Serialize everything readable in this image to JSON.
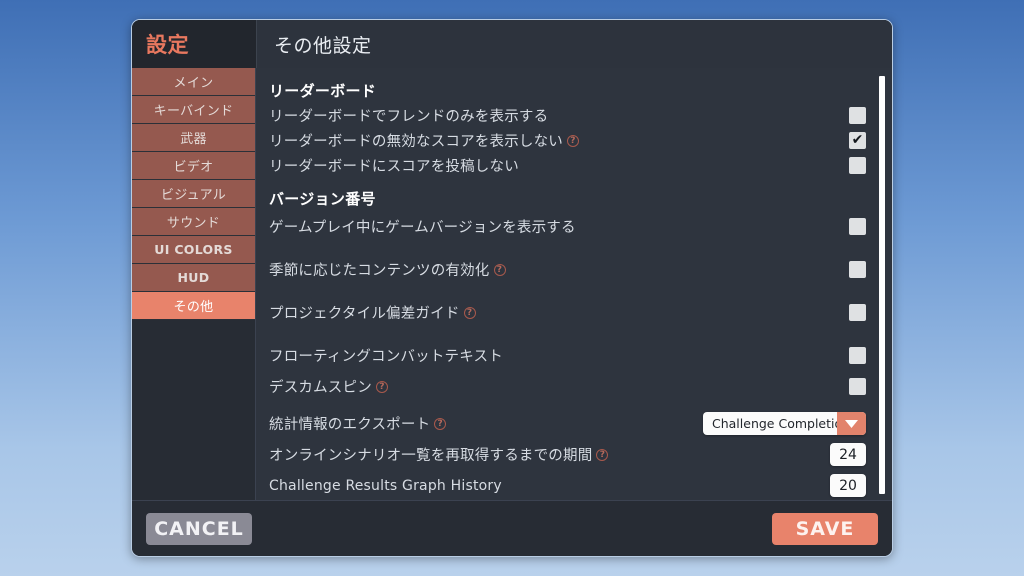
{
  "window": {
    "app_title": "設定",
    "page_title": "その他設定"
  },
  "sidebar": {
    "items": [
      {
        "label": "メイン",
        "active": false,
        "latin": false
      },
      {
        "label": "キーバインド",
        "active": false,
        "latin": false
      },
      {
        "label": "武器",
        "active": false,
        "latin": false
      },
      {
        "label": "ビデオ",
        "active": false,
        "latin": false
      },
      {
        "label": "ビジュアル",
        "active": false,
        "latin": false
      },
      {
        "label": "サウンド",
        "active": false,
        "latin": false
      },
      {
        "label": "UI COLORS",
        "active": false,
        "latin": true
      },
      {
        "label": "HUD",
        "active": false,
        "latin": true
      },
      {
        "label": "その他",
        "active": true,
        "latin": false
      }
    ]
  },
  "content": {
    "group_leaderboard": "リーダーボード",
    "group_version": "バージョン番号",
    "rows": {
      "friends_only": {
        "label": "リーダーボードでフレンドのみを表示する",
        "checked": false,
        "help": false
      },
      "hide_invalid": {
        "label": "リーダーボードの無効なスコアを表示しない",
        "checked": true,
        "help": true
      },
      "no_submit": {
        "label": "リーダーボードにスコアを投稿しない",
        "checked": false,
        "help": false
      },
      "show_version": {
        "label": "ゲームプレイ中にゲームバージョンを表示する",
        "checked": false,
        "help": false
      },
      "seasonal": {
        "label": "季節に応じたコンテンツの有効化",
        "checked": false,
        "help": true
      },
      "projectile": {
        "label": "プロジェクタイル偏差ガイド",
        "checked": false,
        "help": true
      },
      "floating_text": {
        "label": "フローティングコンバットテキスト",
        "checked": false,
        "help": false
      },
      "deathcam": {
        "label": "デスカムスピン",
        "checked": false,
        "help": true
      },
      "export_stats": {
        "label": "統計情報のエクスポート",
        "value": "Challenge Completion",
        "help": true
      },
      "refresh_period": {
        "label": "オンラインシナリオ一覧を再取得するまでの期間",
        "value": "24",
        "help": true
      },
      "graph_history": {
        "label": "Challenge Results Graph History",
        "value": "20",
        "help": false
      }
    },
    "help_icon_glyph": "?"
  },
  "footer": {
    "cancel_label": "CANCEL",
    "save_label": "SAVE"
  },
  "colors": {
    "accent": "#e8836b",
    "sidebar_item": "#95594f",
    "panel": "#2e343e",
    "titlebar": "#272c34",
    "cancel": "#8a8a95"
  }
}
